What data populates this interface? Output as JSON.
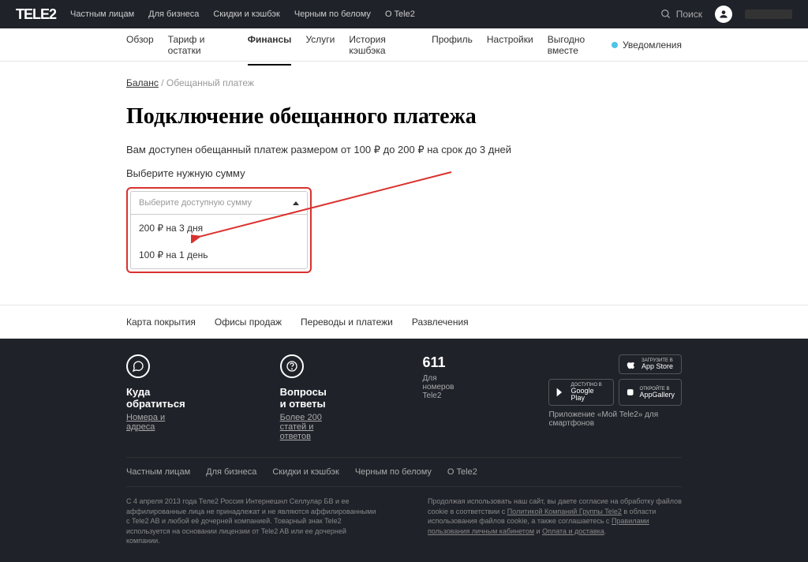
{
  "header": {
    "logo": "TELE2",
    "top_nav": [
      "Частным лицам",
      "Для бизнеса",
      "Скидки и кэшбэк",
      "Черным по белому",
      "О Tele2"
    ],
    "search_label": "Поиск"
  },
  "sub_nav": {
    "items": [
      "Обзор",
      "Тариф и остатки",
      "Финансы",
      "Услуги",
      "История кэшбэка",
      "Профиль",
      "Настройки",
      "Выгодно вместе"
    ],
    "active_index": 2,
    "notifications": "Уведомления"
  },
  "breadcrumb": {
    "link": "Баланс",
    "sep": " / ",
    "current": "Обещанный платеж"
  },
  "page": {
    "title": "Подключение обещанного платежа",
    "description": "Вам доступен обещанный платеж размером от 100 ₽ до 200 ₽ на срок до 3 дней",
    "select_label": "Выберите нужную сумму"
  },
  "dropdown": {
    "placeholder": "Выберите доступную сумму",
    "options": [
      "200 ₽ на 3 дня",
      "100 ₽ на 1 день"
    ]
  },
  "footer_tabs": [
    "Карта покрытия",
    "Офисы продаж",
    "Переводы и платежи",
    "Развлечения"
  ],
  "footer": {
    "contact": {
      "title": "Куда обратиться",
      "sub": "Номера и адреса"
    },
    "faq": {
      "title": "Вопросы и ответы",
      "sub": "Более 200 статей и ответов"
    },
    "phone": {
      "number": "611",
      "sub": "Для номеров Tele2"
    },
    "apps": {
      "appstore": {
        "small": "ЗАГРУЗИТЕ В",
        "big": "App Store"
      },
      "googleplay": {
        "small": "ДОСТУПНО В",
        "big": "Google Play"
      },
      "appgallery": {
        "small": "ОТКРОЙТЕ В",
        "big": "AppGallery"
      },
      "label": "Приложение «Мой Tele2» для смартфонов"
    },
    "bottom_nav": [
      "Частным лицам",
      "Для бизнеса",
      "Скидки и кэшбэк",
      "Черным по белому",
      "О Tele2"
    ]
  },
  "legal": {
    "left": "С 4 апреля 2013 года Теле2 Россия Интернешнл Селлулар БВ и ее аффилированные лица не принадлежат и не являются аффилированными с Tele2 AB и любой её дочерней компанией. Товарный знак Tele2 используется на основании лицензии от Tele2 AB или ее дочерней компании.",
    "right_pre": "Продолжая использовать наш сайт, вы даете согласие на обработку файлов cookie в соответствии с ",
    "right_link1": "Политикой Компаний Группы Tele2",
    "right_mid": " в области использования файлов cookie, а также соглашаетесь с ",
    "right_link2": "Правилами пользования личным кабинетом",
    "right_and": " и ",
    "right_link3": "Оплата и доставка",
    "right_end": "."
  }
}
